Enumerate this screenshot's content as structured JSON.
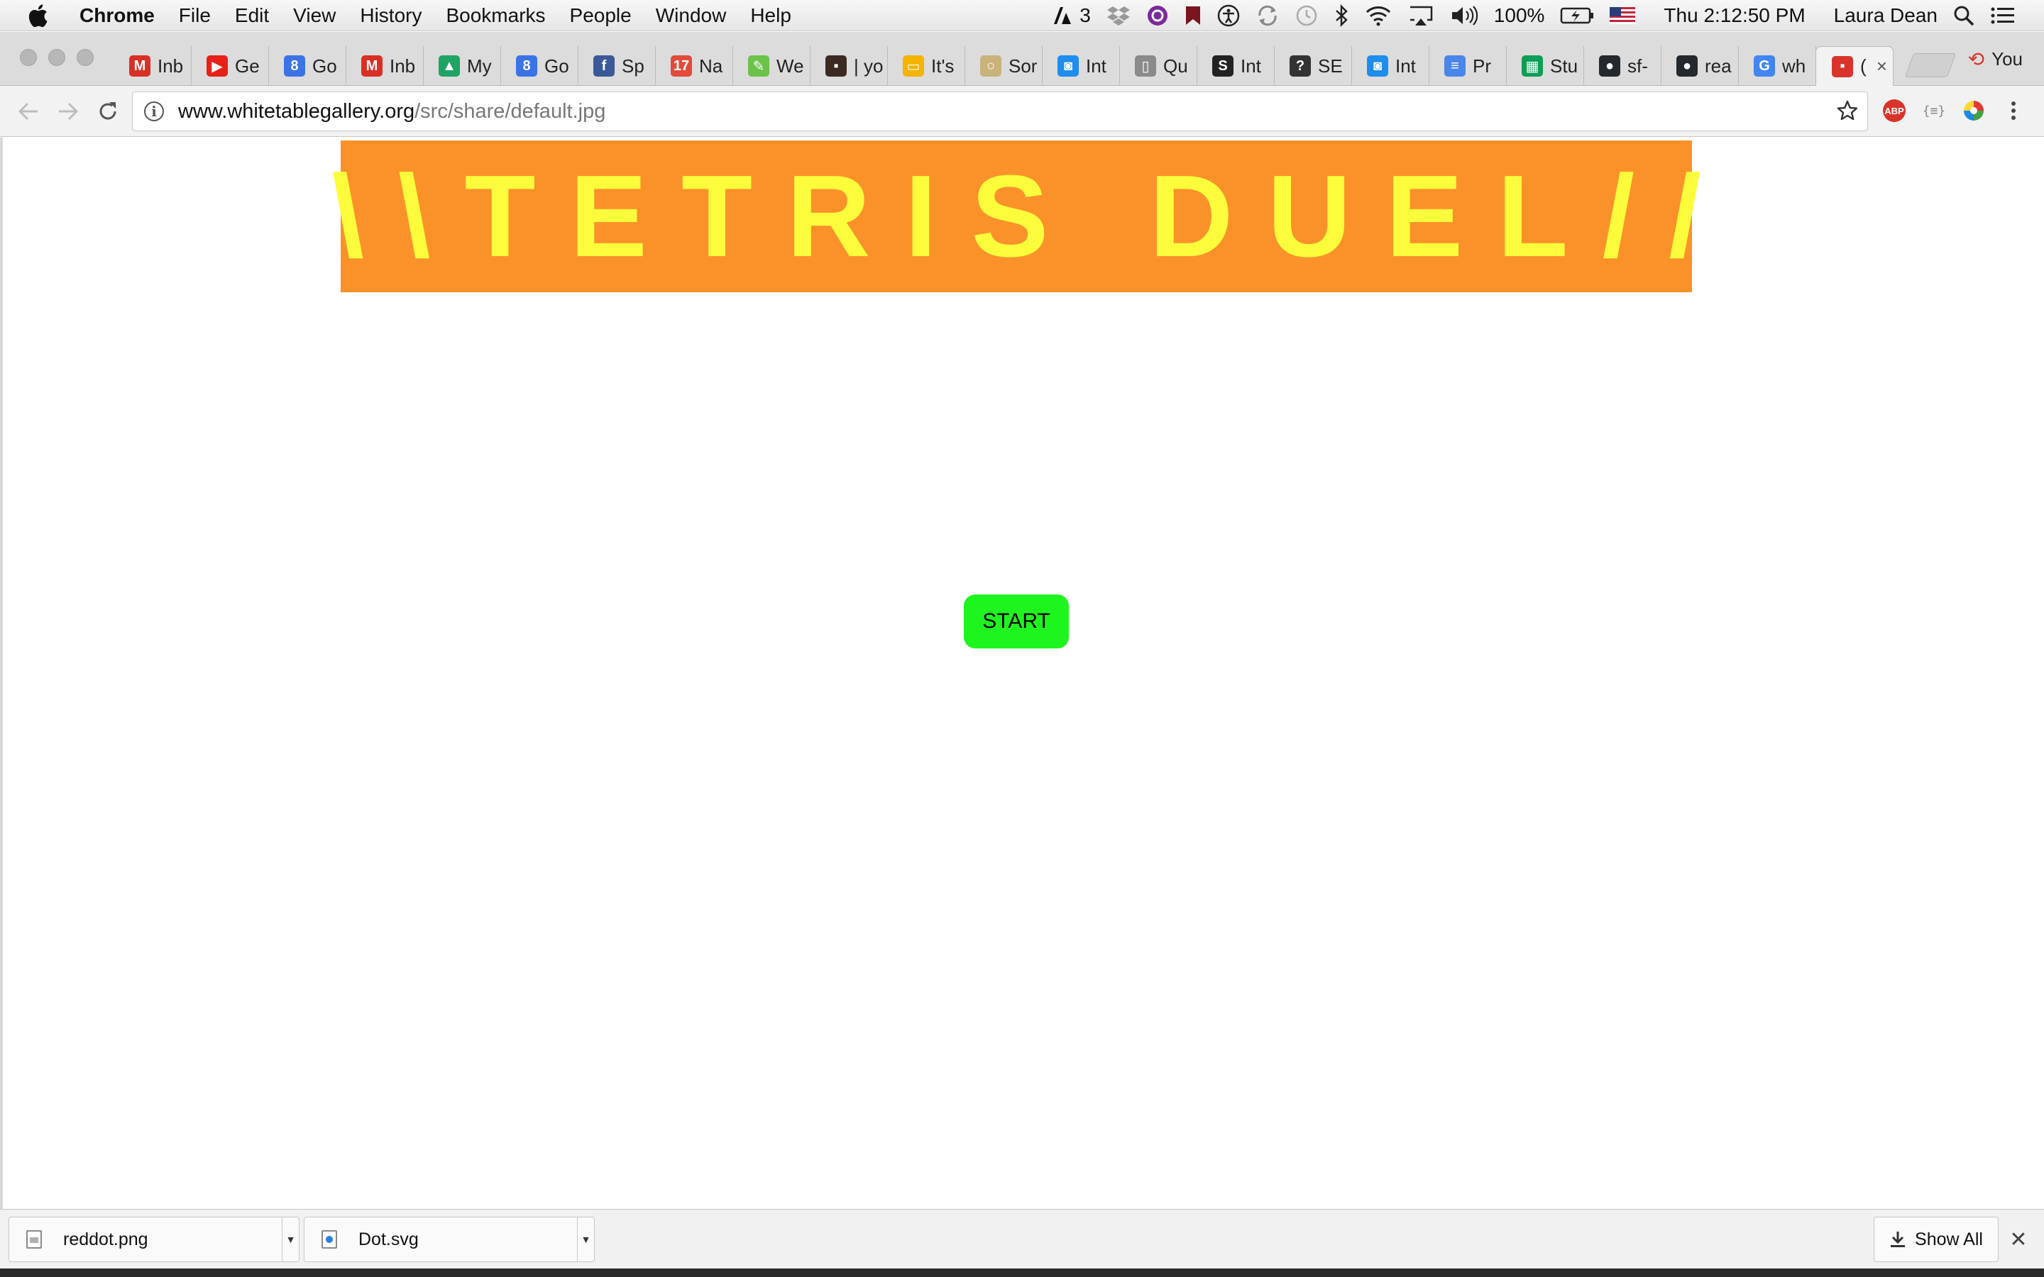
{
  "menubar": {
    "app_name": "Chrome",
    "items": [
      "File",
      "Edit",
      "View",
      "History",
      "Bookmarks",
      "People",
      "Window",
      "Help"
    ],
    "adobe_count": "3",
    "battery": "100%",
    "clock": "Thu 2:12:50 PM",
    "user": "Laura Dean"
  },
  "browser": {
    "tabs": [
      {
        "label": "Inb",
        "icon": "gmail-icon",
        "color": "#d93025",
        "glyph": "M"
      },
      {
        "label": "Ge",
        "icon": "youtube-icon",
        "color": "#e62117",
        "glyph": "▶"
      },
      {
        "label": "Go",
        "icon": "google-calendar-icon",
        "color": "#3b73e6",
        "glyph": "8"
      },
      {
        "label": "Inb",
        "icon": "gmail-icon",
        "color": "#d93025",
        "glyph": "M"
      },
      {
        "label": "My",
        "icon": "google-drive-icon",
        "color": "#1fa463",
        "glyph": "▲"
      },
      {
        "label": "Go",
        "icon": "google-calendar-icon",
        "color": "#3b73e6",
        "glyph": "8"
      },
      {
        "label": "Sp",
        "icon": "facebook-icon",
        "color": "#3b5998",
        "glyph": "f"
      },
      {
        "label": "Na",
        "icon": "calendar-17-icon",
        "color": "#e24b3b",
        "glyph": "17"
      },
      {
        "label": "We",
        "icon": "leaf-icon",
        "color": "#6cc24a",
        "glyph": "✎"
      },
      {
        "label": "| yo",
        "icon": "photo-thumbnail-icon",
        "color": "#3a2a22",
        "glyph": "▪"
      },
      {
        "label": "It's",
        "icon": "slides-icon",
        "color": "#f5b400",
        "glyph": "▭"
      },
      {
        "label": "Sor",
        "icon": "circle-icon",
        "color": "#c9b37a",
        "glyph": "○"
      },
      {
        "label": "Int",
        "icon": "intercom-chat-icon",
        "color": "#1f8ded",
        "glyph": "◙"
      },
      {
        "label": "Qu",
        "icon": "document-icon",
        "color": "#8a8a8a",
        "glyph": "▯"
      },
      {
        "label": "Int",
        "icon": "skype-icon",
        "color": "#222222",
        "glyph": "S"
      },
      {
        "label": "SE",
        "icon": "question-icon",
        "color": "#333333",
        "glyph": "?"
      },
      {
        "label": "Int",
        "icon": "intercom-chat-icon",
        "color": "#1f8ded",
        "glyph": "◙"
      },
      {
        "label": "Pr",
        "icon": "google-docs-icon",
        "color": "#4a86e8",
        "glyph": "≡"
      },
      {
        "label": "Stu",
        "icon": "google-sheets-icon",
        "color": "#0f9d58",
        "glyph": "▦"
      },
      {
        "label": "sf-",
        "icon": "github-icon",
        "color": "#24292e",
        "glyph": "●"
      },
      {
        "label": "rea",
        "icon": "github-icon",
        "color": "#24292e",
        "glyph": "●"
      },
      {
        "label": "wh",
        "icon": "google-icon",
        "color": "#4285f4",
        "glyph": "G"
      },
      {
        "label": "(",
        "icon": "red-favicon-icon",
        "color": "#d9342b",
        "glyph": "▪",
        "active": true
      }
    ],
    "profile_label": "You",
    "url_host": "www.whitetablegallery.org",
    "url_path": "/src/share/default.jpg"
  },
  "page": {
    "banner_title": "\\\\TETRIS DUEL//",
    "start_label": "START",
    "colors": {
      "banner_bg": "#fb9229",
      "banner_text": "#fcfc3c",
      "start_bg": "#1ef51e"
    }
  },
  "downloads": {
    "items": [
      {
        "name": "reddot.png",
        "icon": "png-file-icon"
      },
      {
        "name": "Dot.svg",
        "icon": "svg-file-icon"
      }
    ],
    "show_all_label": "Show All"
  }
}
